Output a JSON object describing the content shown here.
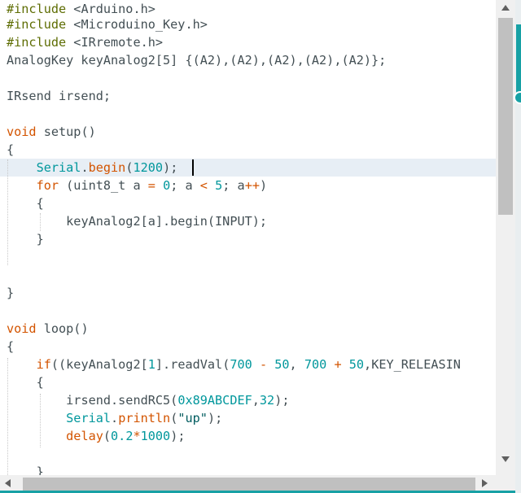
{
  "editor": {
    "lines": {
      "l1": {
        "pre": "#include",
        "rest": " <Arduino.h>"
      },
      "l2": {
        "pre": "#include",
        "rest": " <Microduino_Key.h>"
      },
      "l3": {
        "pre": "#include",
        "rest": " <IRremote.h>"
      },
      "l4": {
        "a": "AnalogKey keyAnalog2[5] {(A2),(A2),(A2),(A2),(A2)};"
      },
      "l6": {
        "a": "IRsend irsend;"
      },
      "l8": {
        "kw": "void",
        "fn": " setup",
        "rest": "()"
      },
      "l9": {
        "a": "{"
      },
      "l10": {
        "indent": "    ",
        "ty": "Serial",
        "dot": ".",
        "fn": "begin",
        "p1": "(",
        "num": "1200",
        "p2": ");"
      },
      "l11": {
        "indent": "    ",
        "kw": "for",
        "a": " (uint8_t a ",
        "op1": "=",
        "b": " ",
        "n1": "0",
        "c": "; a ",
        "op2": "<",
        "d": " ",
        "n2": "5",
        "e": "; a",
        "op3": "++",
        "f": ")"
      },
      "l12": {
        "indent": "    ",
        "a": "{"
      },
      "l13": {
        "indent": "        ",
        "a": "keyAnalog2[a].begin(INPUT);"
      },
      "l14": {
        "indent": "    ",
        "a": "}"
      },
      "l17": {
        "a": "}"
      },
      "l19": {
        "kw": "void",
        "fn": " loop",
        "rest": "()"
      },
      "l20": {
        "a": "{"
      },
      "l21": {
        "indent": "    ",
        "kw": "if",
        "a": "((keyAnalog2[",
        "n1": "1",
        "b": "].readVal(",
        "n2": "700",
        "c": " ",
        "op1": "-",
        "d": " ",
        "n3": "50",
        "e": ", ",
        "n4": "700",
        "f": " ",
        "op2": "+",
        "g": " ",
        "n5": "50",
        "h": ",KEY_RELEASIN"
      },
      "l22": {
        "indent": "    ",
        "a": "{"
      },
      "l23": {
        "indent": "        ",
        "a": "irsend.sendRC5(",
        "n1": "0x89ABCDEF",
        "b": ",",
        "n2": "32",
        "c": ");"
      },
      "l24": {
        "indent": "        ",
        "ty": "Serial",
        "dot": ".",
        "fn": "println",
        "p1": "(",
        "str": "\"up\"",
        "p2": ");"
      },
      "l25": {
        "indent": "        ",
        "fn": "delay",
        "p1": "(",
        "n1": "0.2",
        "op": "*",
        "n2": "1000",
        "p2": ");"
      },
      "l27": {
        "indent": "    ",
        "a": "}"
      }
    }
  },
  "colors": {
    "keyword": "#d35400",
    "type": "#00979c",
    "string": "#005c5f",
    "preprocessor": "#5e6d03",
    "current_line": "#e7eef5",
    "accent": "#17a1a5"
  },
  "icons": {
    "scroll_up": "triangle-up",
    "scroll_down": "triangle-down",
    "scroll_left": "triangle-left",
    "scroll_right": "triangle-right"
  }
}
